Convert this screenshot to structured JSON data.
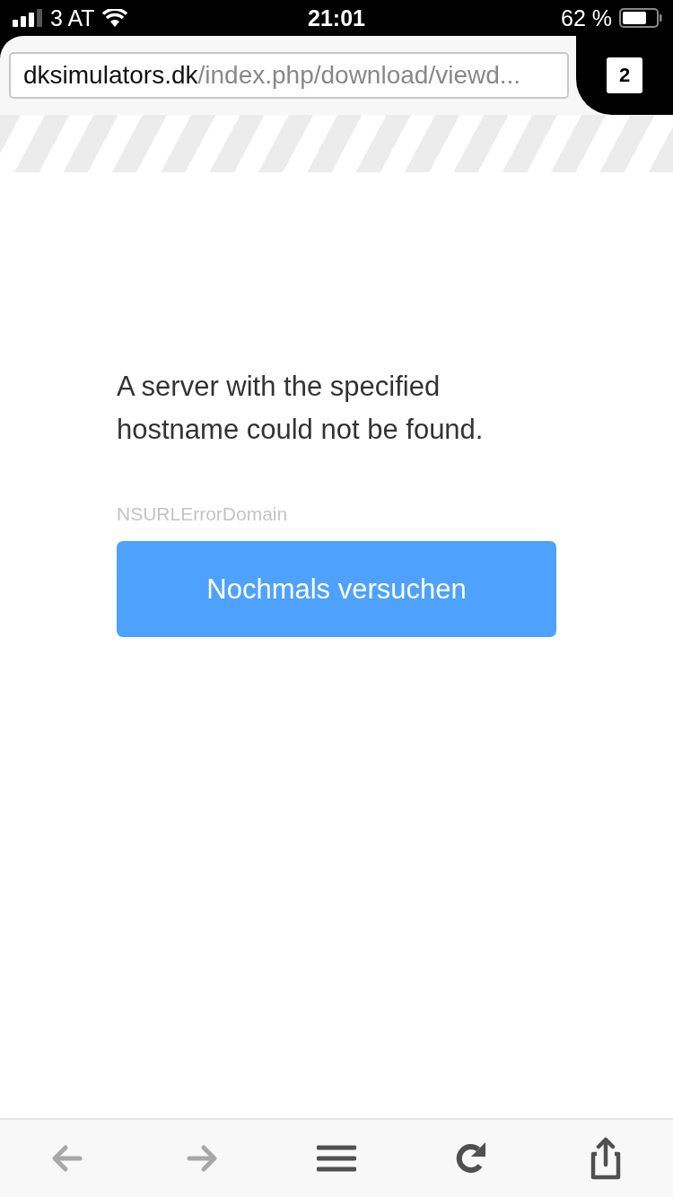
{
  "status_bar": {
    "carrier": "3 AT",
    "time": "21:01",
    "battery": "62 %"
  },
  "address_bar": {
    "host": "dksimulators.dk",
    "path": "/index.php/download/viewd...",
    "tab_count": "2"
  },
  "error": {
    "message": "A server with the specified hostname could not be found.",
    "domain": "NSURLErrorDomain",
    "retry_button": "Nochmals versuchen"
  },
  "toolbar": [
    {
      "kind": "back",
      "disabled": true
    },
    {
      "kind": "forward",
      "disabled": true
    },
    {
      "kind": "menu",
      "disabled": false
    },
    {
      "kind": "reload",
      "disabled": false
    },
    {
      "kind": "share",
      "disabled": false
    }
  ]
}
